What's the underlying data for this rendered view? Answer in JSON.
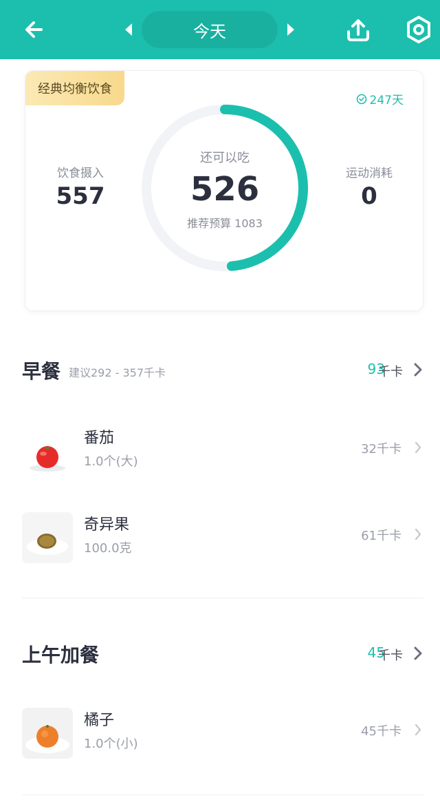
{
  "header": {
    "date_label": "今天",
    "colors": {
      "brand": "#1cbfad"
    },
    "icons": [
      "back-arrow-icon",
      "prev-triangle-icon",
      "next-triangle-icon",
      "share-upload-icon",
      "settings-hexagon-icon"
    ]
  },
  "summary": {
    "diet_tag": "经典均衡饮食",
    "streak": "247天",
    "intake_label": "饮食摄入",
    "intake_value": "557",
    "remaining_label": "还可以吃",
    "remaining_value": "526",
    "budget_text": "推荐预算 1083",
    "exercise_label": "运动消耗",
    "exercise_value": "0",
    "ring_fraction": 0.486
  },
  "meals": [
    {
      "title": "早餐",
      "hint": "建议292 - 357千卡",
      "kcal": "93",
      "unit": "千卡",
      "items": [
        {
          "name": "番茄",
          "amount": "1.0个(大)",
          "kcal": "32千卡"
        },
        {
          "name": "奇异果",
          "amount": "100.0克",
          "kcal": "61千卡"
        }
      ]
    },
    {
      "title": "上午加餐",
      "hint": "",
      "kcal": "45",
      "unit": "千卡",
      "items": [
        {
          "name": "橘子",
          "amount": "1.0个(小)",
          "kcal": "45千卡"
        }
      ]
    }
  ]
}
